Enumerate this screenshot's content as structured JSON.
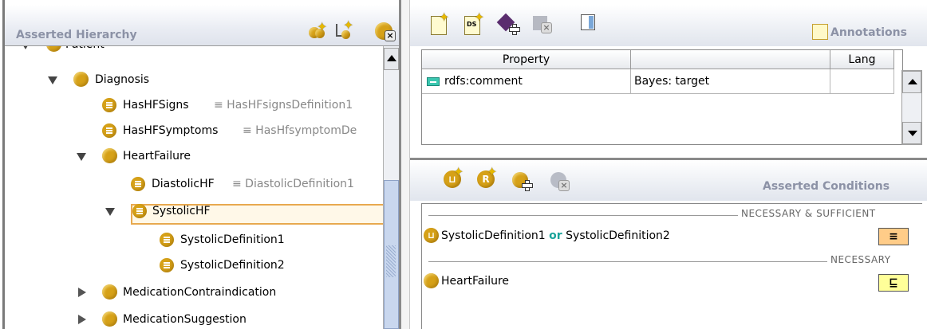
{
  "left_panel": {
    "title": "Asserted Hierarchy",
    "toolbar_icons": [
      "add-subclass-icon",
      "add-sibling-class-icon",
      "delete-class-icon"
    ],
    "tree": [
      {
        "label": "Patient",
        "equiv": "",
        "expanded": true,
        "icon": "class-icon"
      },
      {
        "label": "Diagnosis",
        "equiv": "",
        "expanded": true,
        "icon": "class-icon"
      },
      {
        "label": "HasHFSigns",
        "equiv": "≡ HasHFsignsDefinition1",
        "icon": "defined-class-icon"
      },
      {
        "label": "HasHFSymptoms",
        "equiv": "≡ HasHfsymptomDe",
        "icon": "defined-class-icon"
      },
      {
        "label": "HeartFailure",
        "equiv": "",
        "expanded": true,
        "icon": "class-icon"
      },
      {
        "label": "DiastolicHF",
        "equiv": "≡ DiastolicDefinition1",
        "icon": "defined-class-icon"
      },
      {
        "label": "SystolicHF",
        "equiv": "",
        "expanded": true,
        "selected": true,
        "icon": "defined-class-icon"
      },
      {
        "label": "SystolicDefinition1",
        "equiv": "",
        "icon": "defined-class-icon"
      },
      {
        "label": "SystolicDefinition2",
        "equiv": "",
        "icon": "defined-class-icon"
      },
      {
        "label": "MedicationContraindication",
        "equiv": "",
        "expanded": false,
        "icon": "class-icon"
      },
      {
        "label": "MedicationSuggestion",
        "equiv": "",
        "expanded": false,
        "icon": "class-icon"
      }
    ]
  },
  "annotations": {
    "title": "Annotations",
    "toolbar_icons": [
      "new-annotation-icon",
      "new-datatype-annotation-icon",
      "add-resource-icon",
      "delete-annotation-icon",
      "view-icon"
    ],
    "columns": [
      "Property",
      "",
      "Lang"
    ],
    "rows": [
      {
        "property": "rdfs:comment",
        "value": "Bayes: target",
        "lang": ""
      }
    ]
  },
  "conditions": {
    "title": "Asserted Conditions",
    "toolbar_icons": [
      "create-union-icon",
      "create-restriction-icon",
      "add-named-class-icon",
      "remove-condition-icon"
    ],
    "sections": [
      {
        "label": "NECESSARY & SUFFICIENT",
        "items": [
          {
            "left": "SystolicDefinition1",
            "op": "or",
            "right": "SystolicDefinition2",
            "badge": "≡"
          }
        ]
      },
      {
        "label": "NECESSARY",
        "items": [
          {
            "left": "HeartFailure",
            "badge": "⊑"
          }
        ]
      }
    ]
  },
  "colors": {
    "class_gold": "#d6a118",
    "selection_border": "#e8a94f",
    "or_keyword": "#1aa39a",
    "equiv_badge": "#ffcc88",
    "subclass_badge": "#ffff99",
    "header_text": "#8c92a6"
  }
}
